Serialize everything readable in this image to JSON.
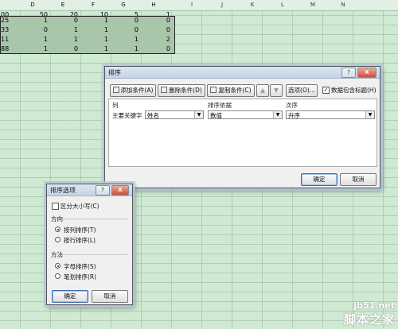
{
  "sheet": {
    "columns": [
      "D",
      "E",
      "F",
      "G",
      "H",
      "I",
      "J",
      "K",
      "L",
      "M",
      "N"
    ],
    "header_row": [
      "00",
      "50",
      "20",
      "10",
      "5",
      "1"
    ],
    "rows": [
      [
        "25",
        "1",
        "0",
        "1",
        "0",
        "0"
      ],
      [
        "33",
        "0",
        "1",
        "1",
        "0",
        "0"
      ],
      [
        "11",
        "1",
        "1",
        "1",
        "1",
        "2"
      ],
      [
        "88",
        "1",
        "0",
        "1",
        "1",
        "0"
      ]
    ]
  },
  "sort_dialog": {
    "title": "排序",
    "help_icon": "?",
    "close_icon": "X",
    "toolbar": {
      "add": "添加条件(A)",
      "delete": "删除条件(D)",
      "copy": "复制条件(C)",
      "up": "▲",
      "down": "▼",
      "options": "选项(O)...",
      "header_checkbox": "数据包含标题(H)",
      "header_checked": true
    },
    "headers": {
      "column": "列",
      "basis": "排序依据",
      "order": "次序"
    },
    "rule": {
      "key_label": "主要关键字",
      "column_value": "姓名",
      "basis_value": "数值",
      "order_value": "升序"
    },
    "ok": "确定",
    "cancel": "取消"
  },
  "options_dialog": {
    "title": "排序选项",
    "help_icon": "?",
    "close_icon": "X",
    "case_sensitive": "区分大小写(C)",
    "case_checked": false,
    "direction_label": "方向",
    "by_column": "按列排序(T)",
    "by_row": "按行排序(L)",
    "direction_selected": "by_column",
    "method_label": "方法",
    "alpha": "字母排序(S)",
    "stroke": "笔划排序(R)",
    "method_selected": "alpha",
    "ok": "确定",
    "cancel": "取消"
  },
  "watermark": {
    "site": "jb51.net",
    "name": "脚本之家"
  }
}
